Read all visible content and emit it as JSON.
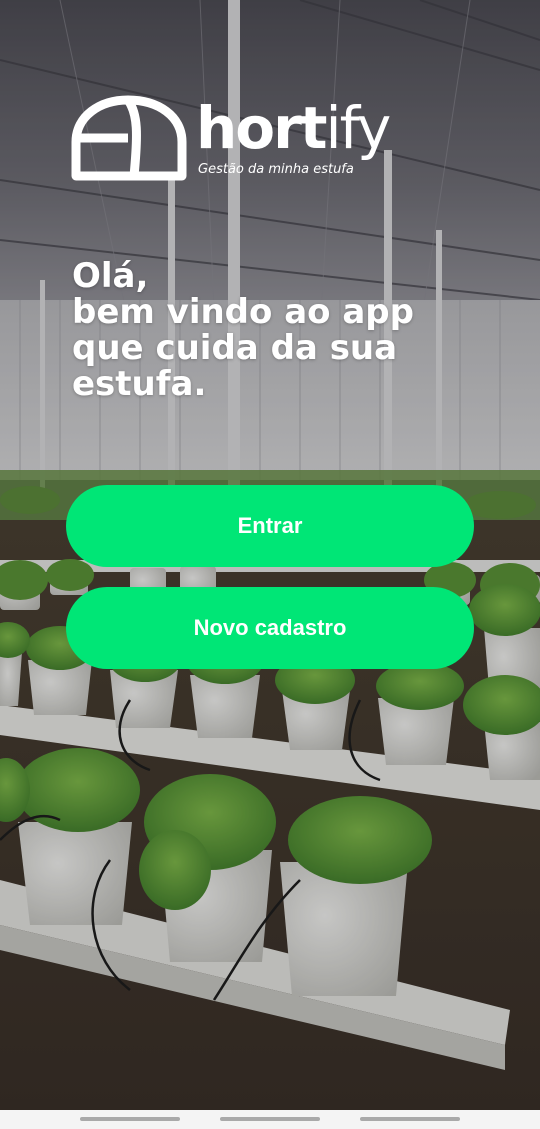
{
  "brand": {
    "name_bold": "hort",
    "name_thin": "ify",
    "tagline": "Gestão da minha estufa"
  },
  "welcome": {
    "lines": [
      "Olá,",
      "bem vindo ao app",
      "que cuida da sua",
      "estufa."
    ]
  },
  "actions": {
    "login_label": "Entrar",
    "register_label": "Novo cadastro"
  },
  "colors": {
    "accent": "#00e676",
    "text_on_accent": "#ffffff",
    "heading": "#ffffff"
  },
  "background": {
    "icon": "greenhouse-lettuce-photo"
  }
}
